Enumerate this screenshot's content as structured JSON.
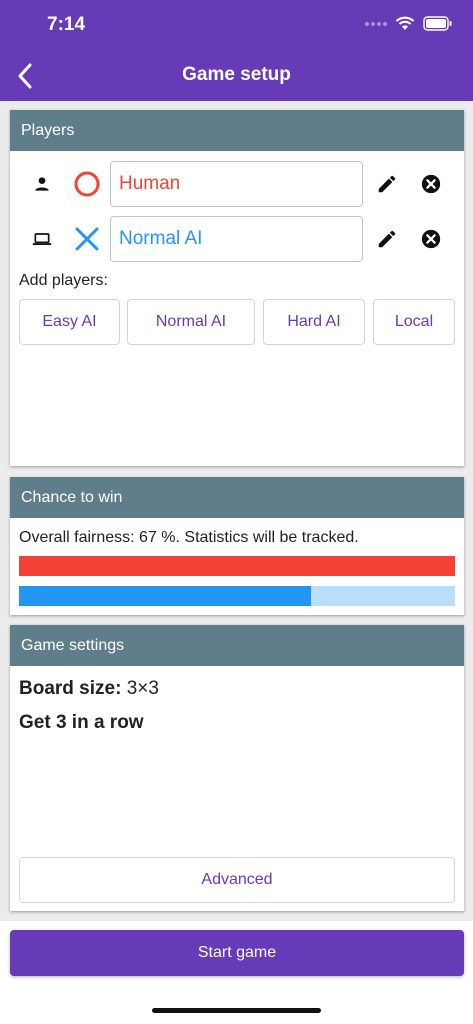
{
  "status_bar": {
    "time": "7:14"
  },
  "header": {
    "title": "Game setup",
    "back_icon": "chevron-left-icon"
  },
  "players_card": {
    "title": "Players",
    "players": [
      {
        "type_icon": "person-icon",
        "mark": "circle",
        "mark_color": "#f44336",
        "name": "Human",
        "name_color": "#f44336"
      },
      {
        "type_icon": "laptop-icon",
        "mark": "cross",
        "mark_color": "#2196f3",
        "name": "Normal AI",
        "name_color": "#2196f3"
      }
    ],
    "add_label": "Add players:",
    "add_buttons": [
      "Easy AI",
      "Normal AI",
      "Hard AI",
      "Local"
    ]
  },
  "chance_card": {
    "title": "Chance to win",
    "fairness_text": "Overall fairness: 67 %. Statistics will be tracked.",
    "player1_chance": 1.0,
    "player2_chance": 0.67,
    "colors": {
      "player1": "#f44336",
      "player2": "#2196f3",
      "player2_track": "#bbdefb"
    }
  },
  "settings_card": {
    "title": "Game settings",
    "board_size_label": "Board size:",
    "board_size_value": "3×3",
    "win_rule": "Get 3 in a row",
    "advanced_label": "Advanced"
  },
  "footer": {
    "start_label": "Start game"
  },
  "colors": {
    "accent": "#673ab7",
    "card_header": "#607d8b"
  }
}
